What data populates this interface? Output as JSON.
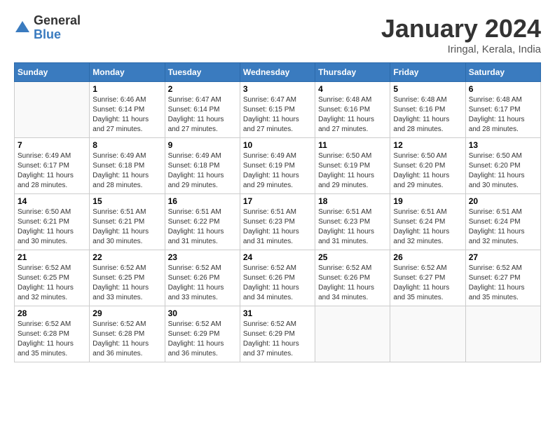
{
  "logo": {
    "general": "General",
    "blue": "Blue"
  },
  "header": {
    "month": "January 2024",
    "location": "Iringal, Kerala, India"
  },
  "weekdays": [
    "Sunday",
    "Monday",
    "Tuesday",
    "Wednesday",
    "Thursday",
    "Friday",
    "Saturday"
  ],
  "weeks": [
    [
      {
        "day": "",
        "sunrise": "",
        "sunset": "",
        "daylight": ""
      },
      {
        "day": "1",
        "sunrise": "Sunrise: 6:46 AM",
        "sunset": "Sunset: 6:14 PM",
        "daylight": "Daylight: 11 hours and 27 minutes."
      },
      {
        "day": "2",
        "sunrise": "Sunrise: 6:47 AM",
        "sunset": "Sunset: 6:14 PM",
        "daylight": "Daylight: 11 hours and 27 minutes."
      },
      {
        "day": "3",
        "sunrise": "Sunrise: 6:47 AM",
        "sunset": "Sunset: 6:15 PM",
        "daylight": "Daylight: 11 hours and 27 minutes."
      },
      {
        "day": "4",
        "sunrise": "Sunrise: 6:48 AM",
        "sunset": "Sunset: 6:16 PM",
        "daylight": "Daylight: 11 hours and 27 minutes."
      },
      {
        "day": "5",
        "sunrise": "Sunrise: 6:48 AM",
        "sunset": "Sunset: 6:16 PM",
        "daylight": "Daylight: 11 hours and 28 minutes."
      },
      {
        "day": "6",
        "sunrise": "Sunrise: 6:48 AM",
        "sunset": "Sunset: 6:17 PM",
        "daylight": "Daylight: 11 hours and 28 minutes."
      }
    ],
    [
      {
        "day": "7",
        "sunrise": "Sunrise: 6:49 AM",
        "sunset": "Sunset: 6:17 PM",
        "daylight": "Daylight: 11 hours and 28 minutes."
      },
      {
        "day": "8",
        "sunrise": "Sunrise: 6:49 AM",
        "sunset": "Sunset: 6:18 PM",
        "daylight": "Daylight: 11 hours and 28 minutes."
      },
      {
        "day": "9",
        "sunrise": "Sunrise: 6:49 AM",
        "sunset": "Sunset: 6:18 PM",
        "daylight": "Daylight: 11 hours and 29 minutes."
      },
      {
        "day": "10",
        "sunrise": "Sunrise: 6:49 AM",
        "sunset": "Sunset: 6:19 PM",
        "daylight": "Daylight: 11 hours and 29 minutes."
      },
      {
        "day": "11",
        "sunrise": "Sunrise: 6:50 AM",
        "sunset": "Sunset: 6:19 PM",
        "daylight": "Daylight: 11 hours and 29 minutes."
      },
      {
        "day": "12",
        "sunrise": "Sunrise: 6:50 AM",
        "sunset": "Sunset: 6:20 PM",
        "daylight": "Daylight: 11 hours and 29 minutes."
      },
      {
        "day": "13",
        "sunrise": "Sunrise: 6:50 AM",
        "sunset": "Sunset: 6:20 PM",
        "daylight": "Daylight: 11 hours and 30 minutes."
      }
    ],
    [
      {
        "day": "14",
        "sunrise": "Sunrise: 6:50 AM",
        "sunset": "Sunset: 6:21 PM",
        "daylight": "Daylight: 11 hours and 30 minutes."
      },
      {
        "day": "15",
        "sunrise": "Sunrise: 6:51 AM",
        "sunset": "Sunset: 6:21 PM",
        "daylight": "Daylight: 11 hours and 30 minutes."
      },
      {
        "day": "16",
        "sunrise": "Sunrise: 6:51 AM",
        "sunset": "Sunset: 6:22 PM",
        "daylight": "Daylight: 11 hours and 31 minutes."
      },
      {
        "day": "17",
        "sunrise": "Sunrise: 6:51 AM",
        "sunset": "Sunset: 6:23 PM",
        "daylight": "Daylight: 11 hours and 31 minutes."
      },
      {
        "day": "18",
        "sunrise": "Sunrise: 6:51 AM",
        "sunset": "Sunset: 6:23 PM",
        "daylight": "Daylight: 11 hours and 31 minutes."
      },
      {
        "day": "19",
        "sunrise": "Sunrise: 6:51 AM",
        "sunset": "Sunset: 6:24 PM",
        "daylight": "Daylight: 11 hours and 32 minutes."
      },
      {
        "day": "20",
        "sunrise": "Sunrise: 6:51 AM",
        "sunset": "Sunset: 6:24 PM",
        "daylight": "Daylight: 11 hours and 32 minutes."
      }
    ],
    [
      {
        "day": "21",
        "sunrise": "Sunrise: 6:52 AM",
        "sunset": "Sunset: 6:25 PM",
        "daylight": "Daylight: 11 hours and 32 minutes."
      },
      {
        "day": "22",
        "sunrise": "Sunrise: 6:52 AM",
        "sunset": "Sunset: 6:25 PM",
        "daylight": "Daylight: 11 hours and 33 minutes."
      },
      {
        "day": "23",
        "sunrise": "Sunrise: 6:52 AM",
        "sunset": "Sunset: 6:26 PM",
        "daylight": "Daylight: 11 hours and 33 minutes."
      },
      {
        "day": "24",
        "sunrise": "Sunrise: 6:52 AM",
        "sunset": "Sunset: 6:26 PM",
        "daylight": "Daylight: 11 hours and 34 minutes."
      },
      {
        "day": "25",
        "sunrise": "Sunrise: 6:52 AM",
        "sunset": "Sunset: 6:26 PM",
        "daylight": "Daylight: 11 hours and 34 minutes."
      },
      {
        "day": "26",
        "sunrise": "Sunrise: 6:52 AM",
        "sunset": "Sunset: 6:27 PM",
        "daylight": "Daylight: 11 hours and 35 minutes."
      },
      {
        "day": "27",
        "sunrise": "Sunrise: 6:52 AM",
        "sunset": "Sunset: 6:27 PM",
        "daylight": "Daylight: 11 hours and 35 minutes."
      }
    ],
    [
      {
        "day": "28",
        "sunrise": "Sunrise: 6:52 AM",
        "sunset": "Sunset: 6:28 PM",
        "daylight": "Daylight: 11 hours and 35 minutes."
      },
      {
        "day": "29",
        "sunrise": "Sunrise: 6:52 AM",
        "sunset": "Sunset: 6:28 PM",
        "daylight": "Daylight: 11 hours and 36 minutes."
      },
      {
        "day": "30",
        "sunrise": "Sunrise: 6:52 AM",
        "sunset": "Sunset: 6:29 PM",
        "daylight": "Daylight: 11 hours and 36 minutes."
      },
      {
        "day": "31",
        "sunrise": "Sunrise: 6:52 AM",
        "sunset": "Sunset: 6:29 PM",
        "daylight": "Daylight: 11 hours and 37 minutes."
      },
      {
        "day": "",
        "sunrise": "",
        "sunset": "",
        "daylight": ""
      },
      {
        "day": "",
        "sunrise": "",
        "sunset": "",
        "daylight": ""
      },
      {
        "day": "",
        "sunrise": "",
        "sunset": "",
        "daylight": ""
      }
    ]
  ]
}
